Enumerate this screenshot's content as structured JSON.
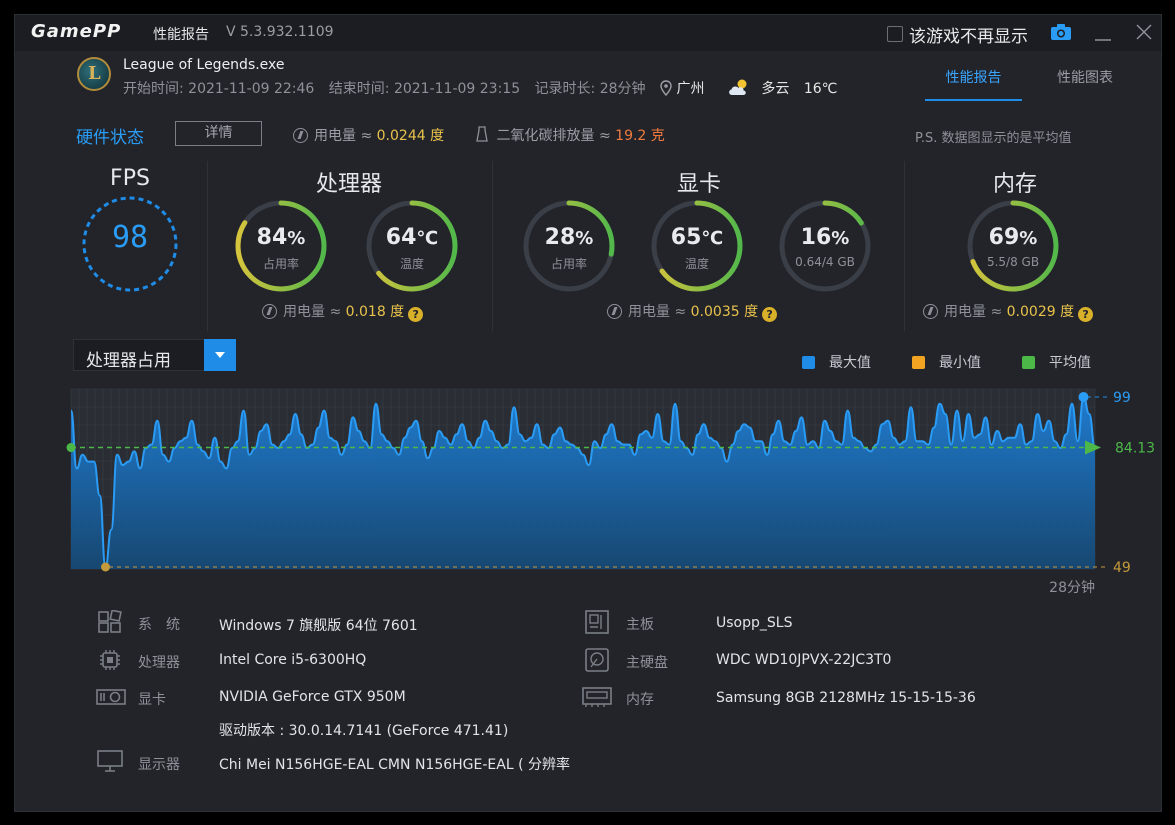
{
  "titlebar": {
    "logo": "GamePP",
    "name": "性能报告",
    "version": "V 5.3.932.1109",
    "dont_show_label": "该游戏不再显示"
  },
  "game": {
    "exe": "League of Legends.exe",
    "icon_letter": "L",
    "start": "开始时间: 2021-11-09 22:46",
    "end": "结束时间: 2021-11-09 23:15",
    "duration": "记录时长: 28分钟",
    "city": "广州",
    "weather": "多云",
    "temp": "16℃"
  },
  "tabs": [
    "性能报告",
    "性能图表"
  ],
  "hardware": {
    "title": "硬件状态",
    "detail_btn": "详情",
    "power_label": "用电量 ≈",
    "power_value": "0.0244 度",
    "co2_label": "二氧化碳排放量 ≈",
    "co2_value": "19.2 克",
    "note": "P.S. 数据图显示的是平均值"
  },
  "sections": {
    "fps": {
      "title": "FPS",
      "value": "98",
      "fraction": 1.0
    },
    "cpu": {
      "title": "处理器",
      "usage": {
        "num": "84",
        "unit": "%",
        "label": "占用率",
        "fraction": 0.84
      },
      "temp": {
        "num": "64",
        "unit": "℃",
        "label": "温度",
        "fraction": 0.64
      },
      "power_label": "用电量 ≈",
      "power_value": "0.018 度"
    },
    "gpu": {
      "title": "显卡",
      "usage": {
        "num": "28",
        "unit": "%",
        "label": "占用率",
        "fraction": 0.28
      },
      "temp": {
        "num": "65",
        "unit": "℃",
        "label": "温度",
        "fraction": 0.65
      },
      "vram": {
        "num": "16",
        "unit": "%",
        "label": "0.64/4 GB",
        "fraction": 0.16
      },
      "power_label": "用电量 ≈",
      "power_value": "0.0035 度"
    },
    "mem": {
      "title": "内存",
      "usage": {
        "num": "69",
        "unit": "%",
        "label": "5.5/8 GB",
        "fraction": 0.69
      },
      "power_label": "用电量 ≈",
      "power_value": "0.0029 度"
    }
  },
  "chart_select": "处理器占用",
  "legend": [
    {
      "label": "最大值",
      "color": "#1f8ce8"
    },
    {
      "label": "最小值",
      "color": "#f2a321"
    },
    {
      "label": "平均值",
      "color": "#4cb848"
    }
  ],
  "chart_data": {
    "type": "area",
    "x_end_label": "28分钟",
    "max_label": "99",
    "min_label": "49",
    "avg_label": "84.13",
    "ylim": [
      49,
      99
    ],
    "values": [
      95,
      78,
      82,
      80,
      80,
      70,
      49,
      60,
      82,
      79,
      80,
      83,
      78,
      84,
      85,
      92,
      82,
      80,
      84,
      86,
      87,
      92,
      85,
      83,
      81,
      87,
      80,
      78,
      84,
      86,
      95,
      82,
      84,
      89,
      91,
      85,
      84,
      86,
      88,
      94,
      88,
      84,
      85,
      90,
      95,
      87,
      86,
      82,
      85,
      93,
      89,
      86,
      84,
      97,
      88,
      86,
      84,
      82,
      87,
      90,
      92,
      86,
      81,
      84,
      89,
      87,
      85,
      88,
      91,
      86,
      84,
      87,
      92,
      89,
      86,
      84,
      85,
      96,
      88,
      86,
      87,
      91,
      85,
      84,
      88,
      90,
      86,
      85,
      84,
      82,
      79,
      86,
      84,
      88,
      91,
      86,
      85,
      85,
      82,
      88,
      89,
      87,
      94,
      86,
      85,
      97,
      86,
      84,
      82,
      88,
      91,
      87,
      86,
      84,
      80,
      85,
      89,
      91,
      90,
      86,
      86,
      82,
      88,
      92,
      86,
      85,
      89,
      93,
      85,
      86,
      84,
      92,
      89,
      86,
      85,
      95,
      87,
      86,
      84,
      83,
      85,
      91,
      92,
      87,
      85,
      86,
      96,
      86,
      86,
      85,
      90,
      97,
      94,
      85,
      95,
      86,
      94,
      87,
      88,
      93,
      85,
      89,
      86,
      87,
      87,
      91,
      85,
      86,
      94,
      89,
      92,
      86,
      84,
      88,
      97,
      86,
      99,
      94,
      84
    ]
  },
  "sysinfo": [
    {
      "label": "系　统",
      "value": "Windows 7 旗舰版 64位   7601",
      "icon": "windows-icon"
    },
    {
      "label": "处理器",
      "value": "Intel Core i5-6300HQ",
      "icon": "cpu-icon"
    },
    {
      "label": "显卡",
      "value": "NVIDIA GeForce GTX 950M",
      "icon": "gpu-icon"
    },
    {
      "label": "",
      "value": "驱动版本 : 30.0.14.7141 (GeForce 471.41)",
      "icon": ""
    },
    {
      "label": "显示器",
      "value": "Chi Mei N156HGE-EAL CMN N156HGE-EAL ( 分辨率",
      "icon": "monitor-icon"
    },
    {
      "label": "主板",
      "value": "Usopp_SLS",
      "icon": "motherboard-icon"
    },
    {
      "label": "主硬盘",
      "value": "WDC WD10JPVX-22JC3T0",
      "icon": "harddisk-icon"
    },
    {
      "label": "内存",
      "value": "Samsung 8GB 2128MHz 15-15-15-36",
      "icon": "ram-icon"
    }
  ]
}
